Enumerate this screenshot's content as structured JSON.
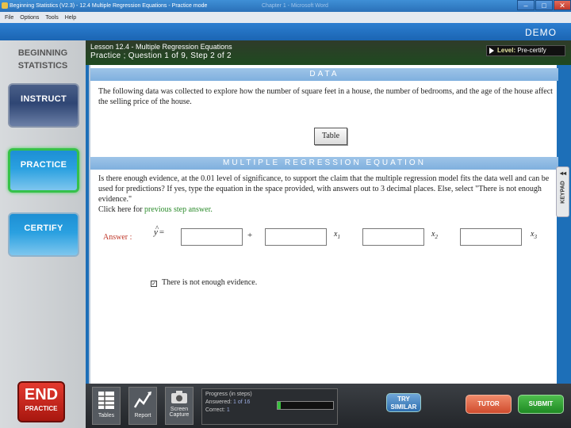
{
  "window": {
    "title": "Beginning Statistics (V2.3) - 12.4 Multiple Regression Equations - Practice mode",
    "ghost_title": "Chapter 1 - Microsoft Word",
    "minimize": "–",
    "maximize": "□",
    "close": "✕"
  },
  "menu": {
    "items": [
      "File",
      "Options",
      "Tools",
      "Help"
    ]
  },
  "mode_label": "DEMO",
  "sidebar": {
    "brand_line1": "BEGINNING",
    "brand_line2": "STATISTICS",
    "instruct": "INSTRUCT",
    "practice": "PRACTICE",
    "certify": "CERTIFY"
  },
  "lesson": {
    "line1": "Lesson 12.4 - Multiple Regression Equations",
    "line2": "Practice ; Question 1 of 9, Step 2 of 2",
    "level_label": "Level:",
    "level_value": "Pre-certify"
  },
  "data_section": {
    "header": "DATA",
    "text": "The following data was collected to explore how the number of square feet in a house, the number of bedrooms, and the age of the house affect the selling price of the house.",
    "table_button": "Table"
  },
  "equation_section": {
    "header": "MULTIPLE REGRESSION EQUATION",
    "question": "Is there enough evidence, at the 0.01 level of significance, to support the claim that the multiple regression model fits the data well and can be used for predictions? If yes, type the equation in the space provided, with answers out to 3 decimal places. Else, select \"There is not enough evidence.\"",
    "click_prefix": "Click here for ",
    "click_link": "previous step answer.",
    "answer_label": "Answer :",
    "yhat": "y",
    "hat": "^",
    "equals": "=",
    "plus": "+",
    "x_var": "x",
    "sub1": "1",
    "sub2": "2",
    "sub3": "3",
    "not_enough_checkbox": "✓",
    "not_enough_label": "There is not enough evidence."
  },
  "keypad": {
    "label": "KEYPAD",
    "arrow": "◂◂"
  },
  "bottom": {
    "end_big": "END",
    "end_small": "PRACTICE",
    "tables": "Tables",
    "report": "Report",
    "screen_line1": "Screen",
    "screen_line2": "Capture",
    "progress_title": "Progress (in steps)",
    "answered_label": "Answered:",
    "answered_value": "1 of 16",
    "correct_label": "Correct:",
    "correct_value": "1",
    "progress_fraction": 0.0625,
    "try_line1": "TRY",
    "try_line2": "SIMILAR",
    "tutor": "TUTOR",
    "submit": "SUBMIT"
  }
}
